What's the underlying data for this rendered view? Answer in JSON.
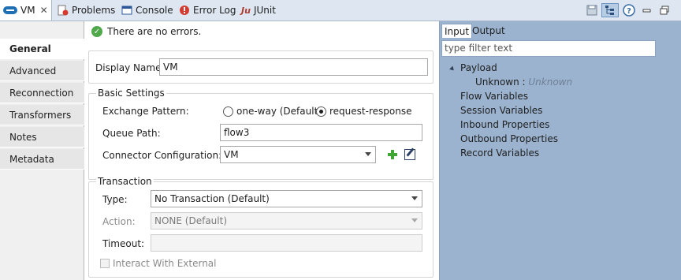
{
  "tabs": {
    "active": {
      "label": "VM",
      "icon": "vm-connector-icon",
      "close": "✕"
    },
    "problems": {
      "label": "Problems",
      "icon": "problems-icon"
    },
    "console": {
      "label": "Console",
      "icon": "console-icon"
    },
    "error_log": {
      "label": "Error Log",
      "icon": "error-log-icon"
    },
    "junit": {
      "label": "JUnit",
      "icon_text": "Ju"
    }
  },
  "toolbar": {
    "icons": [
      "save-icon",
      "tree-view-icon",
      "help-icon",
      "minimize-icon",
      "maximize-icon"
    ]
  },
  "sidenav": {
    "items": [
      {
        "label": "General",
        "active": true
      },
      {
        "label": "Advanced"
      },
      {
        "label": "Reconnection"
      },
      {
        "label": "Transformers"
      },
      {
        "label": "Notes"
      },
      {
        "label": "Metadata"
      }
    ]
  },
  "status": {
    "text": "There are no errors."
  },
  "display": {
    "label": "Display Name:",
    "value": "VM"
  },
  "basic": {
    "title": "Basic Settings",
    "exchange_label": "Exchange Pattern:",
    "radio_oneway": "one-way (Default)",
    "radio_request": "request-response",
    "selected": "request-response",
    "queue_label": "Queue Path:",
    "queue_value": "flow3",
    "connector_label": "Connector Configuration:",
    "connector_value": "VM"
  },
  "transaction": {
    "title": "Transaction",
    "type_label": "Type:",
    "type_value": "No Transaction (Default)",
    "action_label": "Action:",
    "action_value": "NONE (Default)",
    "timeout_label": "Timeout:",
    "timeout_value": "",
    "interact_label": "Interact With External"
  },
  "rightpanel": {
    "tab_input": "Input",
    "tab_output": "Output",
    "filter_placeholder": "type filter text",
    "payload": "Payload",
    "unknown_label": "Unknown :",
    "unknown_value": "Unknown",
    "items": [
      "Flow Variables",
      "Session Variables",
      "Inbound Properties",
      "Outbound Properties",
      "Record Variables"
    ]
  },
  "colors": {
    "panel_bg": "#9bb3cf",
    "tab_bar_bg": "#dde6f1",
    "ok_green": "#4fa84a",
    "vm_blue": "#1f6fb5"
  }
}
